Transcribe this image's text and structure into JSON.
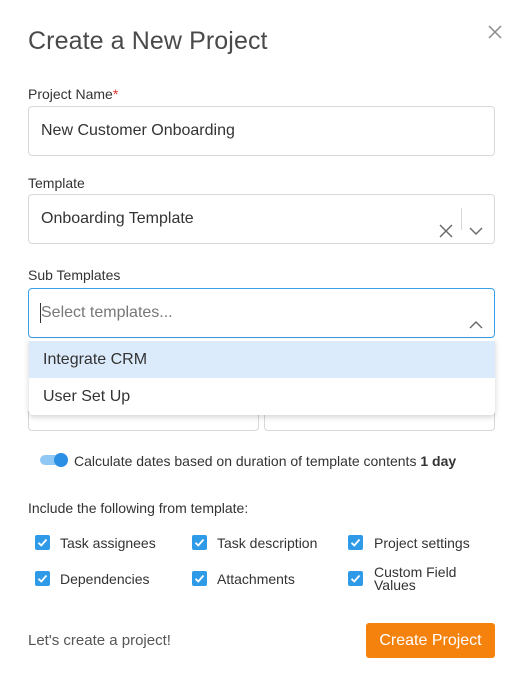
{
  "modal": {
    "title": "Create a New Project"
  },
  "project_name": {
    "label": "Project Name",
    "required_mark": "*",
    "value": "New Customer Onboarding"
  },
  "template": {
    "label": "Template",
    "value": "Onboarding Template"
  },
  "sub_templates": {
    "label": "Sub Templates",
    "placeholder": "Select templates...",
    "options": [
      "Integrate CRM",
      "User Set Up"
    ]
  },
  "calculate_dates": {
    "enabled": true,
    "text": "Calculate dates based on duration of template contents",
    "duration": "1 day"
  },
  "include": {
    "label": "Include the following from template:",
    "options": [
      {
        "label": "Task assignees",
        "checked": true
      },
      {
        "label": "Task description",
        "checked": true
      },
      {
        "label": "Project settings",
        "checked": true
      },
      {
        "label": "Dependencies",
        "checked": true
      },
      {
        "label": "Attachments",
        "checked": true
      },
      {
        "label": "Custom Field",
        "label2": "Values",
        "checked": true
      }
    ]
  },
  "footer": {
    "text": "Let's create a project!",
    "button_label": "Create Project"
  },
  "colors": {
    "accent": "#f5820d",
    "focus": "#3aa0e8",
    "checkbox": "#2f9ae8",
    "highlight": "#dcebfb"
  },
  "icons": {
    "close": "close-icon",
    "clear": "clear-icon",
    "dropdown": "chevron-down-icon",
    "collapse": "chevron-up-icon",
    "check": "checkmark-icon"
  }
}
